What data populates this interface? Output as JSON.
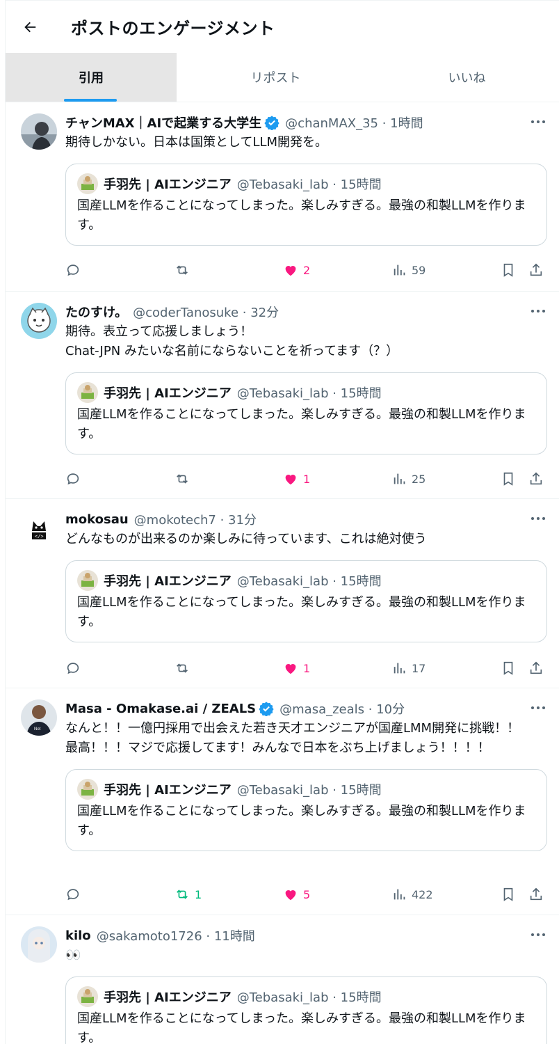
{
  "page": {
    "title": "ポストのエンゲージメント",
    "tabs": [
      {
        "label": "引用"
      },
      {
        "label": "リポスト"
      },
      {
        "label": "いいね"
      }
    ]
  },
  "quoted": {
    "name": "手羽先 | AIエンジニア",
    "handle": "@Tebasaki_lab · 15時間",
    "text": "国産LLMを作ることになってしまった。楽しみすぎる。最強の和製LLMを作ります。"
  },
  "posts": [
    {
      "name": "チャンMAX｜AIで起業する大学生",
      "handle": "@chanMAX_35 · 1時間",
      "text": "期待しかない。日本は国策としてLLM開発を。",
      "retweets": "",
      "likes": "2",
      "views": "59"
    },
    {
      "name": "たのすけ。",
      "handle": "@coderTanosuke · 32分",
      "text": "期待。表立って応援しましょう！\nChat-JPN みたいな名前にならないことを祈ってます（？）",
      "retweets": "",
      "likes": "1",
      "views": "25"
    },
    {
      "name": "mokosau",
      "handle": "@mokotech7 · 31分",
      "text": "どんなものが出来るのか楽しみに待っています、これは絶対使う",
      "retweets": "",
      "likes": "1",
      "views": "17"
    },
    {
      "name": "Masa - Omakase.ai / ZEALS",
      "handle": "@masa_zeals · 10分",
      "text": "なんと！！一億円採用で出会えた若き天才エンジニアが国産LMM開発に挑戦！！最高！！！マジで応援してます！みんなで日本をぶち上げましょう！！！！",
      "retweets": "1",
      "likes": "5",
      "views": "422"
    },
    {
      "name": "kilo",
      "handle": "@sakamoto1726 · 11時間",
      "text": "👀",
      "retweets": "",
      "likes": "",
      "views": ""
    }
  ],
  "colors": {
    "accent": "#1d9bf0",
    "like": "#f91880",
    "retweet_active": "#00ba7c",
    "muted": "#536471"
  }
}
